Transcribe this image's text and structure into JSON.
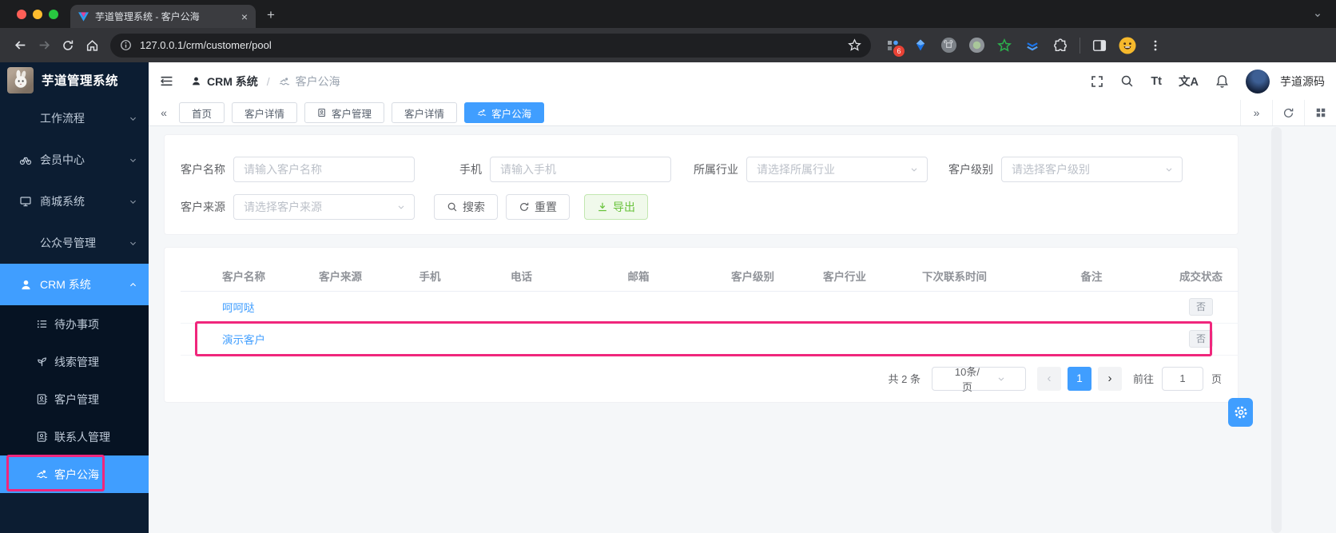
{
  "browser": {
    "tab_title": "芋道管理系统 - 客户公海",
    "tab_close": "×",
    "new_tab_label": "+",
    "url": "127.0.0.1/crm/customer/pool",
    "extension_badge": "6"
  },
  "sidebar": {
    "logo_title": "芋道管理系统",
    "items": [
      {
        "label": "工作流程"
      },
      {
        "label": "会员中心"
      },
      {
        "label": "商城系统"
      },
      {
        "label": "公众号管理"
      },
      {
        "label": "CRM 系统"
      }
    ],
    "crm_children": [
      {
        "label": "待办事项"
      },
      {
        "label": "线索管理"
      },
      {
        "label": "客户管理"
      },
      {
        "label": "联系人管理"
      },
      {
        "label": "客户公海"
      }
    ]
  },
  "header": {
    "breadcrumb_1": "CRM 系统",
    "breadcrumb_sep": "/",
    "breadcrumb_2": "客户公海",
    "font_icon_label": "Tt",
    "locale_icon_label": "文A",
    "username": "芋道源码"
  },
  "tabbar": {
    "collapse_left": "«",
    "collapse_right": "»",
    "tabs": [
      {
        "label": "首页"
      },
      {
        "label": "客户详情"
      },
      {
        "label": "客户管理"
      },
      {
        "label": "客户详情"
      },
      {
        "label": "客户公海"
      }
    ]
  },
  "filters": {
    "name_label": "客户名称",
    "name_placeholder": "请输入客户名称",
    "mobile_label": "手机",
    "mobile_placeholder": "请输入手机",
    "industry_label": "所属行业",
    "industry_placeholder": "请选择所属行业",
    "level_label": "客户级别",
    "level_placeholder": "请选择客户级别",
    "source_label": "客户来源",
    "source_placeholder": "请选择客户来源",
    "search_label": "搜索",
    "reset_label": "重置",
    "export_label": "导出"
  },
  "table": {
    "headers": [
      "客户名称",
      "客户来源",
      "手机",
      "电话",
      "邮箱",
      "客户级别",
      "客户行业",
      "下次联系时间",
      "备注",
      "成交状态"
    ],
    "rows": [
      {
        "name": "呵呵哒",
        "deal_status": "否"
      },
      {
        "name": "演示客户",
        "deal_status": "否"
      }
    ]
  },
  "pagination": {
    "total": "共 2 条",
    "page_size": "10条/页",
    "prev": "‹",
    "next": "›",
    "current_page": "1",
    "goto_label": "前往",
    "goto_value": "1",
    "page_unit": "页"
  },
  "colors": {
    "primary": "#409eff",
    "annotation_pink": "#f0267c",
    "export_green": "#67c23a",
    "sidebar_bg": "#0c1d32"
  }
}
